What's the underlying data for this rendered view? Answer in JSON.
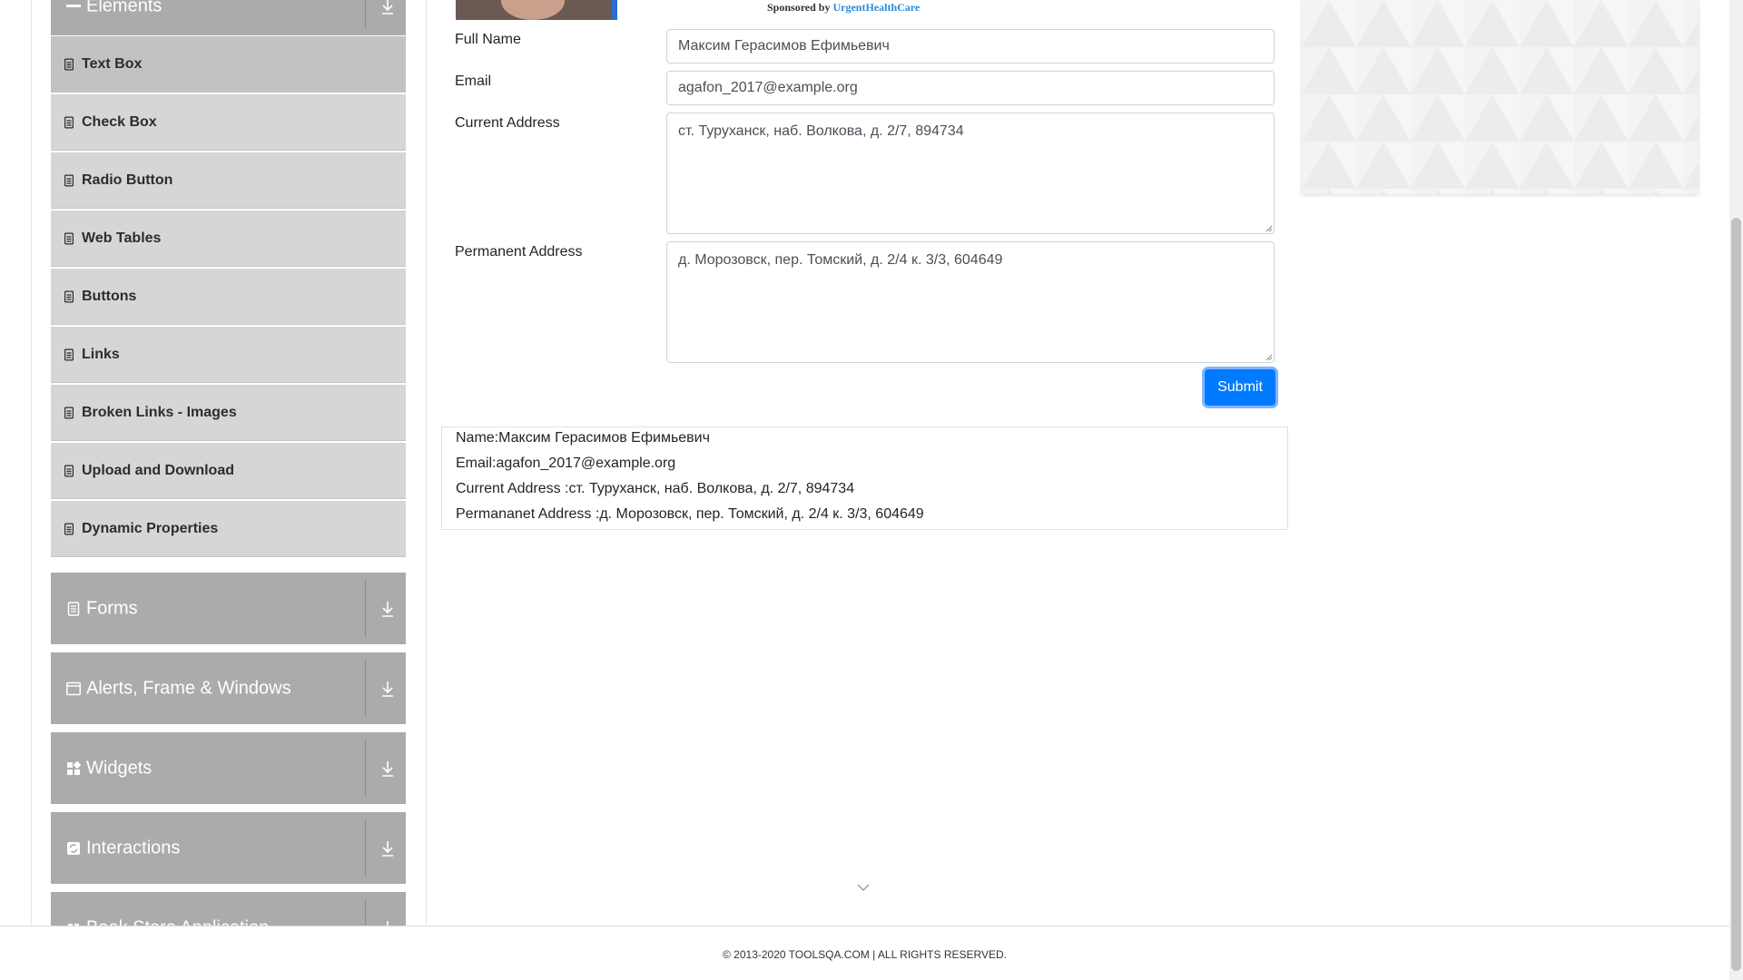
{
  "sidebar": {
    "elements_header": "Elements",
    "items": [
      {
        "label": "Text Box",
        "active": true
      },
      {
        "label": "Check Box"
      },
      {
        "label": "Radio Button"
      },
      {
        "label": "Web Tables"
      },
      {
        "label": "Buttons"
      },
      {
        "label": "Links"
      },
      {
        "label": "Broken Links - Images"
      },
      {
        "label": "Upload and Download"
      },
      {
        "label": "Dynamic Properties"
      }
    ],
    "groups": [
      {
        "label": "Forms",
        "icon": "form-icon"
      },
      {
        "label": "Alerts, Frame & Windows",
        "icon": "window-icon"
      },
      {
        "label": "Widgets",
        "icon": "widgets-icon"
      },
      {
        "label": "Interactions",
        "icon": "interactions-icon"
      },
      {
        "label": "Book Store Application",
        "icon": "bookstore-icon"
      }
    ]
  },
  "sponsor": {
    "prefix": "Sponsored by ",
    "name": "UrgentHealthCare"
  },
  "form": {
    "full_name_label": "Full Name",
    "full_name_value": "Максим Герасимов Ефимьевич",
    "email_label": "Email",
    "email_value": "agafon_2017@example.org",
    "current_address_label": "Current Address",
    "current_address_value": "ст. Туруханск, наб. Волкова, д. 2/7, 894734",
    "permanent_address_label": "Permanent Address",
    "permanent_address_value": "д. Морозовск, пер. Томский, д. 2/4 к. 3/3, 604649",
    "submit_label": "Submit"
  },
  "output": {
    "name": "Name:Максим Герасимов Ефимьевич",
    "email": "Email:agafon_2017@example.org",
    "current_address": "Current Address :ст. Туруханск, наб. Волкова, д. 2/7, 894734",
    "permanent_address": "Permananet Address :д. Морозовск, пер. Томский, д. 2/4 к. 3/3, 604649"
  },
  "footer": {
    "text": "© 2013-2020 TOOLSQA.COM | ALL RIGHTS RESERVED."
  },
  "colors": {
    "accent": "#007bff",
    "menu_bg": "#d6d6d6",
    "group_bg": "#ababab"
  }
}
